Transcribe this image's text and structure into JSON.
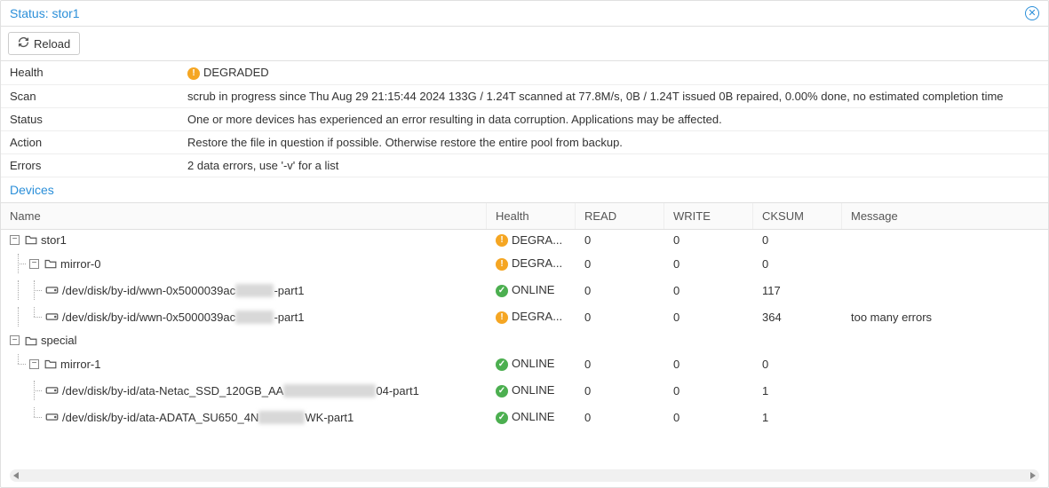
{
  "header": {
    "title": "Status: stor1"
  },
  "toolbar": {
    "reload_label": "Reload"
  },
  "info": {
    "labels": {
      "health": "Health",
      "scan": "Scan",
      "status": "Status",
      "action": "Action",
      "errors": "Errors"
    },
    "health": "DEGRADED",
    "scan": "scrub in progress since Thu Aug 29 21:15:44 2024 133G / 1.24T scanned at 77.8M/s, 0B / 1.24T issued 0B repaired, 0.00% done, no estimated completion time",
    "status": "One or more devices has experienced an error resulting in data corruption. Applications may be affected.",
    "action": "Restore the file in question if possible. Otherwise restore the entire pool from backup.",
    "errors": "2 data errors, use '-v' for a list"
  },
  "devices_title": "Devices",
  "columns": {
    "name": "Name",
    "health": "Health",
    "read": "READ",
    "write": "WRITE",
    "cksum": "CKSUM",
    "message": "Message"
  },
  "rows": [
    {
      "name": "stor1",
      "health": "DEGRA...",
      "hstate": "warn",
      "read": "0",
      "write": "0",
      "cksum": "0",
      "message": ""
    },
    {
      "name": "mirror-0",
      "health": "DEGRA...",
      "hstate": "warn",
      "read": "0",
      "write": "0",
      "cksum": "0",
      "message": ""
    },
    {
      "name_pre": "/dev/disk/by-id/wwn-0x5000039ac",
      "name_blur": "XXXXX",
      "name_post": "-part1",
      "health": "ONLINE",
      "hstate": "ok",
      "read": "0",
      "write": "0",
      "cksum": "117",
      "message": ""
    },
    {
      "name_pre": "/dev/disk/by-id/wwn-0x5000039ac",
      "name_blur": "XXXXX",
      "name_post": "-part1",
      "health": "DEGRA...",
      "hstate": "warn",
      "read": "0",
      "write": "0",
      "cksum": "364",
      "message": "too many errors"
    },
    {
      "name": "special",
      "health": "",
      "hstate": "",
      "read": "",
      "write": "",
      "cksum": "",
      "message": ""
    },
    {
      "name": "mirror-1",
      "health": "ONLINE",
      "hstate": "ok",
      "read": "0",
      "write": "0",
      "cksum": "0",
      "message": ""
    },
    {
      "name_pre": "/dev/disk/by-id/ata-Netac_SSD_120GB_AA",
      "name_blur": "XXXXXXXXXXXX",
      "name_post": "04-part1",
      "health": "ONLINE",
      "hstate": "ok",
      "read": "0",
      "write": "0",
      "cksum": "1",
      "message": ""
    },
    {
      "name_pre": "/dev/disk/by-id/ata-ADATA_SU650_4N",
      "name_blur": "XXXXXX",
      "name_post": "WK-part1",
      "health": "ONLINE",
      "hstate": "ok",
      "read": "0",
      "write": "0",
      "cksum": "1",
      "message": ""
    }
  ]
}
